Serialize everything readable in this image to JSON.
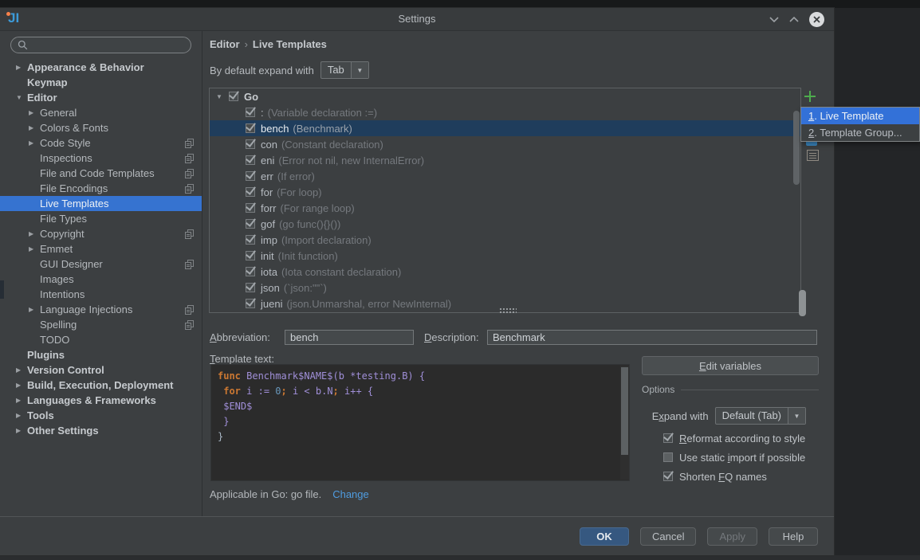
{
  "window": {
    "title": "Settings"
  },
  "sidebar": {
    "search": {
      "value": "",
      "placeholder": ""
    },
    "items": [
      {
        "label": "Appearance & Behavior",
        "bold": true,
        "arrow": "right",
        "level": 0
      },
      {
        "label": "Keymap",
        "bold": true,
        "arrow": "none",
        "level": 0
      },
      {
        "label": "Editor",
        "bold": true,
        "arrow": "down",
        "level": 0
      },
      {
        "label": "General",
        "arrow": "right",
        "level": 1
      },
      {
        "label": "Colors & Fonts",
        "arrow": "right",
        "level": 1
      },
      {
        "label": "Code Style",
        "arrow": "right",
        "level": 1,
        "copy": true
      },
      {
        "label": "Inspections",
        "arrow": "none",
        "level": 1,
        "copy": true
      },
      {
        "label": "File and Code Templates",
        "arrow": "none",
        "level": 1,
        "copy": true
      },
      {
        "label": "File Encodings",
        "arrow": "none",
        "level": 1,
        "copy": true
      },
      {
        "label": "Live Templates",
        "arrow": "none",
        "level": 1,
        "selected": true
      },
      {
        "label": "File Types",
        "arrow": "none",
        "level": 1
      },
      {
        "label": "Copyright",
        "arrow": "right",
        "level": 1,
        "copy": true
      },
      {
        "label": "Emmet",
        "arrow": "right",
        "level": 1
      },
      {
        "label": "GUI Designer",
        "arrow": "none",
        "level": 1,
        "copy": true
      },
      {
        "label": "Images",
        "arrow": "none",
        "level": 1
      },
      {
        "label": "Intentions",
        "arrow": "none",
        "level": 1
      },
      {
        "label": "Language Injections",
        "arrow": "right",
        "level": 1,
        "copy": true
      },
      {
        "label": "Spelling",
        "arrow": "none",
        "level": 1,
        "copy": true
      },
      {
        "label": "TODO",
        "arrow": "none",
        "level": 1
      },
      {
        "label": "Plugins",
        "bold": true,
        "arrow": "none",
        "level": 0
      },
      {
        "label": "Version Control",
        "bold": true,
        "arrow": "right",
        "level": 0
      },
      {
        "label": "Build, Execution, Deployment",
        "bold": true,
        "arrow": "right",
        "level": 0
      },
      {
        "label": "Languages & Frameworks",
        "bold": true,
        "arrow": "right",
        "level": 0
      },
      {
        "label": "Tools",
        "bold": true,
        "arrow": "right",
        "level": 0
      },
      {
        "label": "Other Settings",
        "bold": true,
        "arrow": "right",
        "level": 0
      }
    ]
  },
  "header": {
    "breadcrumb": {
      "parts": [
        "Editor",
        "Live Templates"
      ],
      "separator": "›"
    },
    "default_expand_label": "By default expand with",
    "default_expand_value": "Tab"
  },
  "template_list": {
    "group": {
      "label": "Go",
      "checked": true,
      "expanded": true
    },
    "items": [
      {
        "abbr": ":",
        "desc": "(Variable declaration :=)",
        "checked": true
      },
      {
        "abbr": "bench",
        "desc": "(Benchmark)",
        "checked": true,
        "selected": true
      },
      {
        "abbr": "con",
        "desc": "(Constant declaration)",
        "checked": true
      },
      {
        "abbr": "eni",
        "desc": "(Error not nil, new InternalError)",
        "checked": true
      },
      {
        "abbr": "err",
        "desc": "(If error)",
        "checked": true
      },
      {
        "abbr": "for",
        "desc": "(For loop)",
        "checked": true
      },
      {
        "abbr": "forr",
        "desc": "(For range loop)",
        "checked": true
      },
      {
        "abbr": "gof",
        "desc": "(go func(){}())",
        "checked": true
      },
      {
        "abbr": "imp",
        "desc": "(Import declaration)",
        "checked": true
      },
      {
        "abbr": "init",
        "desc": "(Init function)",
        "checked": true
      },
      {
        "abbr": "iota",
        "desc": "(Iota constant declaration)",
        "checked": true
      },
      {
        "abbr": "json",
        "desc": "(`json:\"\"`)",
        "checked": true
      },
      {
        "abbr": "jueni",
        "desc": "(json.Unmarshal, error NewInternal)",
        "checked": true
      }
    ]
  },
  "add_popup": {
    "items": [
      {
        "label": "1. Live Template",
        "mnemonic_index": 0,
        "selected": true
      },
      {
        "label": "2. Template Group...",
        "mnemonic_index": 0,
        "selected": false
      }
    ]
  },
  "detail": {
    "abbreviation_label": {
      "text": "Abbreviation:",
      "mnemonic_index": 0
    },
    "abbreviation_value": "bench",
    "description_label": {
      "text": "Description:",
      "mnemonic_index": 0
    },
    "description_value": "Benchmark",
    "template_text_label": {
      "text": "Template text:",
      "mnemonic_index": 0
    },
    "code_lines": [
      [
        [
          "kw",
          "func"
        ],
        [
          "id",
          " Benchmark$NAME$(b *testing.B) {"
        ]
      ],
      [
        [
          "pl",
          " "
        ],
        [
          "kw",
          "for"
        ],
        [
          "id",
          " i := "
        ],
        [
          "num",
          "0"
        ],
        [
          "kw",
          ";"
        ],
        [
          "id",
          " i < b.N"
        ],
        [
          "kw",
          ";"
        ],
        [
          "id",
          " i++ {"
        ]
      ],
      [
        [
          "id",
          " $END$"
        ]
      ],
      [
        [
          "id",
          " }"
        ]
      ],
      [
        [
          "pl",
          "}"
        ]
      ]
    ],
    "applicable_text": "Applicable in Go: go file.",
    "change_link": "Change"
  },
  "options_panel": {
    "edit_variables_label": {
      "text": "Edit variables",
      "mnemonic_index": 0
    },
    "group_title": "Options",
    "expand_with_label": {
      "text": "Expand with",
      "mnemonic_index": 1
    },
    "expand_with_value": "Default (Tab)",
    "checkboxes": [
      {
        "label": "Reformat according to style",
        "mnemonic_index": 0,
        "checked": true
      },
      {
        "label": "Use static import if possible",
        "mnemonic_index": 11,
        "checked": false
      },
      {
        "label": "Shorten FQ names",
        "mnemonic_index": 8,
        "checked": true
      }
    ]
  },
  "footer": {
    "buttons": [
      {
        "label": "OK",
        "variant": "primary"
      },
      {
        "label": "Cancel",
        "variant": "normal"
      },
      {
        "label": "Apply",
        "variant": "disabled"
      },
      {
        "label": "Help",
        "variant": "normal"
      }
    ]
  },
  "theme": {
    "sidebar_selection_blue": "#3673d0",
    "popup_selection_blue": "#3371d8",
    "list_selection_navy": "#1f3d5c",
    "plus_green": "#4dac4d",
    "link_blue": "#4f9ce0",
    "primary_button_blue": "#365880",
    "code_keyword_orange": "#cc7832",
    "code_identifier_purple": "#a08fd8",
    "code_number_blue": "#6897bb",
    "dialog_background": "#3c3f41",
    "code_background": "#2b2b2b"
  }
}
